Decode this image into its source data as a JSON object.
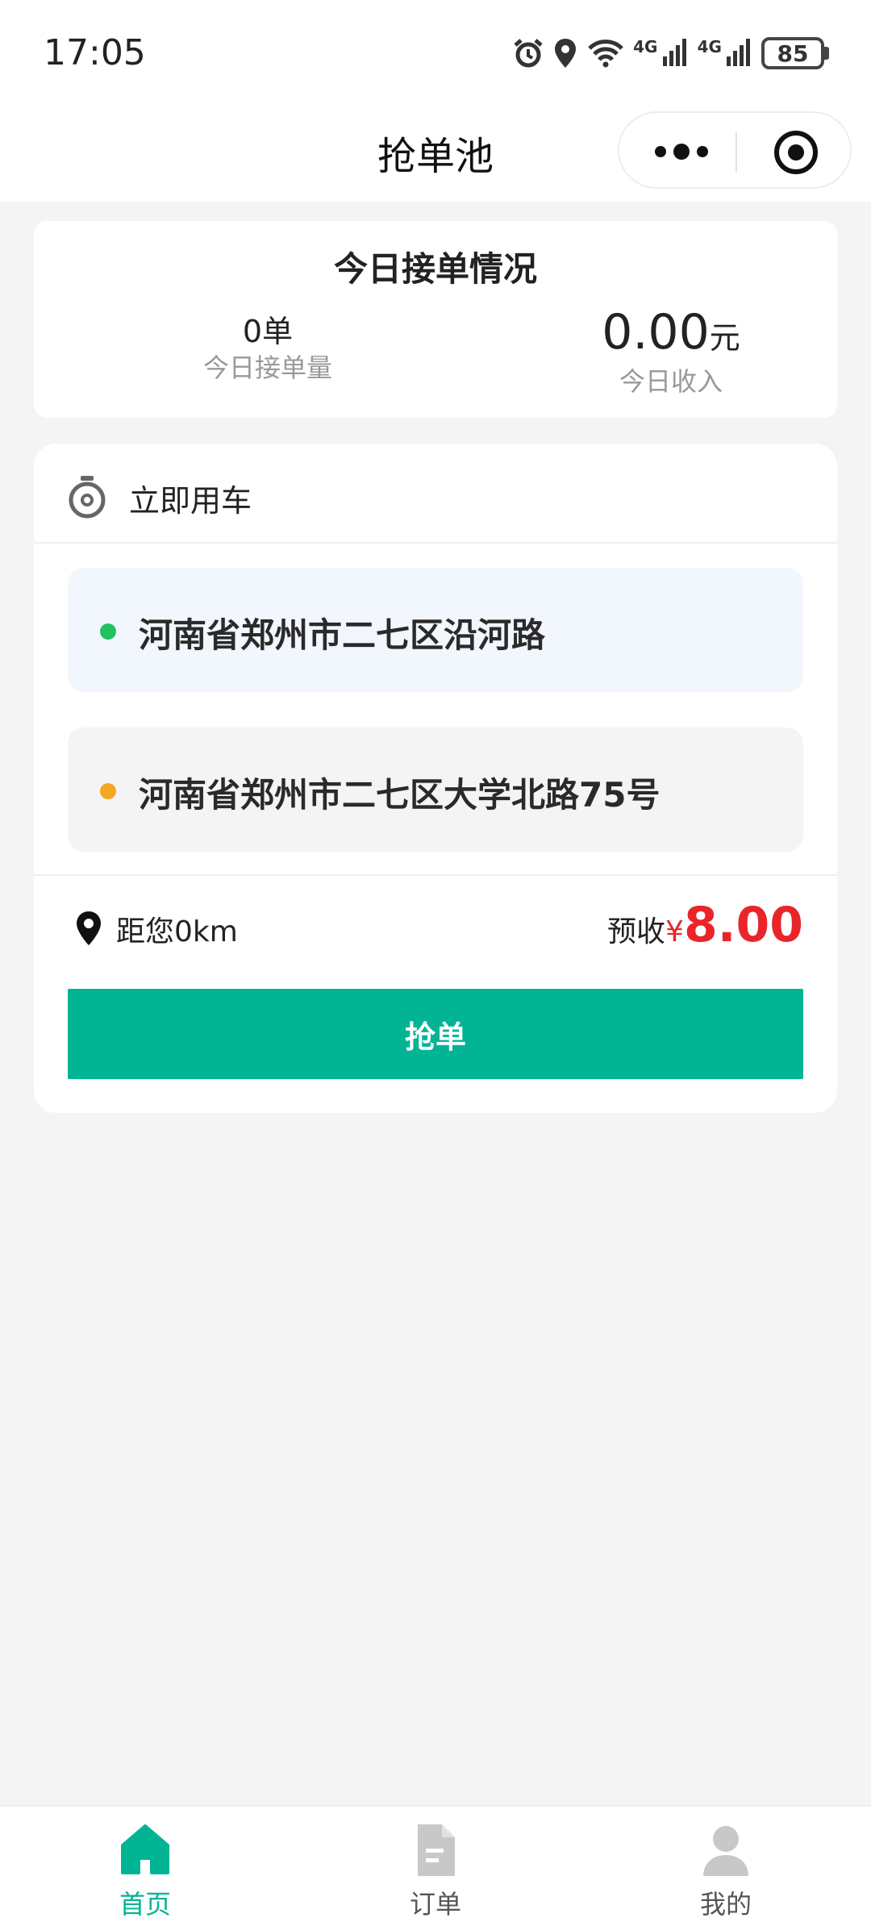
{
  "status_bar": {
    "time": "17:05",
    "network_1": "4G",
    "network_2": "4G",
    "battery": "85"
  },
  "nav": {
    "title": "抢单池"
  },
  "today_stats": {
    "title": "今日接单情况",
    "order_count": "0单",
    "order_count_label": "今日接单量",
    "income_value": "0.00",
    "income_unit": "元",
    "income_label": "今日收入"
  },
  "order": {
    "type_label": "立即用车",
    "pickup_address": "河南省郑州市二七区沿河路",
    "dropoff_address": "河南省郑州市二七区大学北路75号",
    "distance": "距您0km",
    "fee_label": "预收",
    "currency": "¥",
    "fee_amount": "8.00",
    "grab_label": "抢单",
    "pickup_dot_color": "#22c15e",
    "dropoff_dot_color": "#f5a623"
  },
  "tabbar": {
    "active_color": "#00b494",
    "inactive_color": "#c8c8c8",
    "items": [
      {
        "label": "首页",
        "icon": "home-icon",
        "active": true
      },
      {
        "label": "订单",
        "icon": "document-icon",
        "active": false
      },
      {
        "label": "我的",
        "icon": "user-icon",
        "active": false
      }
    ]
  }
}
